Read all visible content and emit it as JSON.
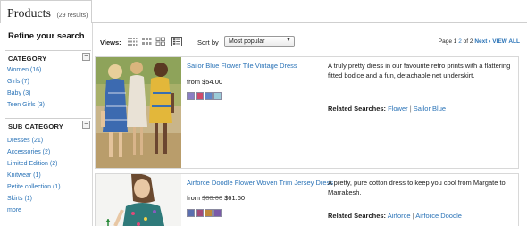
{
  "header": {
    "title": "Products",
    "count": "(29 results)"
  },
  "sidebar": {
    "refine_title": "Refine your search",
    "sections": [
      {
        "title": "CATEGORY",
        "collapse_symbol": "−",
        "items": [
          "Women (16)",
          "Girls (7)",
          "Baby (3)",
          "Teen Girls (3)"
        ]
      },
      {
        "title": "SUB CATEGORY",
        "collapse_symbol": "−",
        "items": [
          "Dresses (21)",
          "Accessories (2)",
          "Limited Edition (2)",
          "Knitwear (1)",
          "Petite collection (1)",
          "Skirts (1)",
          "more"
        ]
      }
    ]
  },
  "toolbar": {
    "views_label": "Views:",
    "view_options": [
      "grid-small-icon",
      "grid-medium-icon",
      "grid-large-icon",
      "list-icon"
    ],
    "active_view": "list-icon",
    "sort_label": "Sort by",
    "sort_value": "Most popular",
    "pager": {
      "prefix": "Page",
      "current": "1",
      "next_page": "2",
      "of_text": "of 2",
      "next_label": "Next ›",
      "view_all": "VIEW ALL"
    }
  },
  "products": [
    {
      "name": "Sailor Blue Flower Tile Vintage Dress",
      "price_prefix": "from",
      "old_price": "",
      "price": "$54.00",
      "swatch_colors": [
        "#8a7fc4",
        "#d04a6a",
        "#5f87c9",
        "#9ccbd8"
      ],
      "description": "A truly pretty dress in our favourite retro prints with a flattering fitted bodice and a fun, detachable net underskirt.",
      "related_label": "Related Searches:",
      "related_links": [
        "Flower",
        "Sailor Blue"
      ],
      "related_sep": "|"
    },
    {
      "name": "Airforce Doodle Flower Woven Trim Jersey Dress",
      "price_prefix": "from",
      "old_price": "$88.00",
      "price": "$61.60",
      "swatch_colors": [
        "#5b6fb0",
        "#a34b7a",
        "#c08a3a",
        "#7a5aa8"
      ],
      "description": "A pretty, pure cotton dress to keep you cool from Margate to Marrakesh.",
      "related_label": "Related Searches:",
      "related_links": [
        "Airforce",
        "Airforce Doodle"
      ],
      "related_sep": "|"
    }
  ],
  "colors": {
    "link": "#2a73b7",
    "border": "#d8d8d8"
  }
}
